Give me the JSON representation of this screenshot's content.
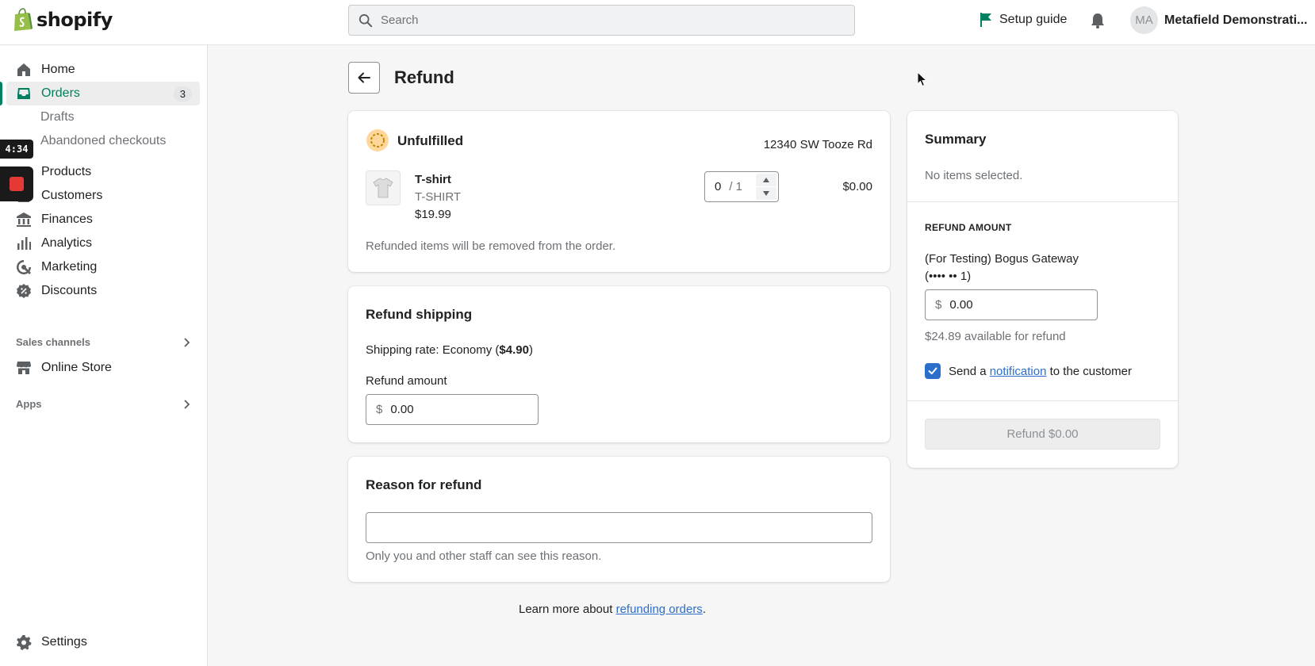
{
  "brand": {
    "logo_text": "shopify",
    "accent": "#008060",
    "link": "#2c6ecb"
  },
  "topbar": {
    "search_placeholder": "Search",
    "setup_guide": "Setup guide",
    "avatar_initials": "MA",
    "store_name": "Metafield Demonstrati..."
  },
  "sidebar": {
    "home": "Home",
    "orders": "Orders",
    "orders_count": "3",
    "drafts": "Drafts",
    "abandoned": "Abandoned checkouts",
    "products": "Products",
    "customers": "Customers",
    "finances": "Finances",
    "analytics": "Analytics",
    "marketing": "Marketing",
    "discounts": "Discounts",
    "sales_channels": "Sales channels",
    "online_store": "Online Store",
    "apps": "Apps",
    "settings": "Settings"
  },
  "recorder": {
    "time": "4:34"
  },
  "page": {
    "title": "Refund"
  },
  "unfulfilled": {
    "status": "Unfulfilled",
    "address": "12340 SW Tooze Rd",
    "item_name": "T-shirt",
    "item_sku": "T-SHIRT",
    "item_price": "$19.99",
    "qty_value": "0",
    "qty_of": "/ 1",
    "line_total": "$0.00",
    "note": "Refunded items will be removed from the order."
  },
  "shipping": {
    "title": "Refund shipping",
    "rate_prefix": "Shipping rate: Economy (",
    "rate_amount": "$4.90",
    "rate_suffix": ")",
    "amount_label": "Refund amount",
    "currency": "$",
    "amount_value": "0.00"
  },
  "reason": {
    "title": "Reason for refund",
    "input_value": "",
    "help": "Only you and other staff can see this reason."
  },
  "footer": {
    "prefix": "Learn more about ",
    "link": "refunding orders",
    "suffix": "."
  },
  "summary": {
    "title": "Summary",
    "no_items": "No items selected.",
    "refund_amount_heading": "REFUND AMOUNT",
    "gateway_line1": "(For Testing) Bogus Gateway",
    "gateway_line2": "(•••• •• 1)",
    "currency": "$",
    "amount_value": "0.00",
    "available": "$24.89 available for refund",
    "notify_prefix": "Send a ",
    "notify_link": "notification",
    "notify_suffix": " to the customer",
    "notify_checked": true,
    "refund_button": "Refund $0.00"
  }
}
